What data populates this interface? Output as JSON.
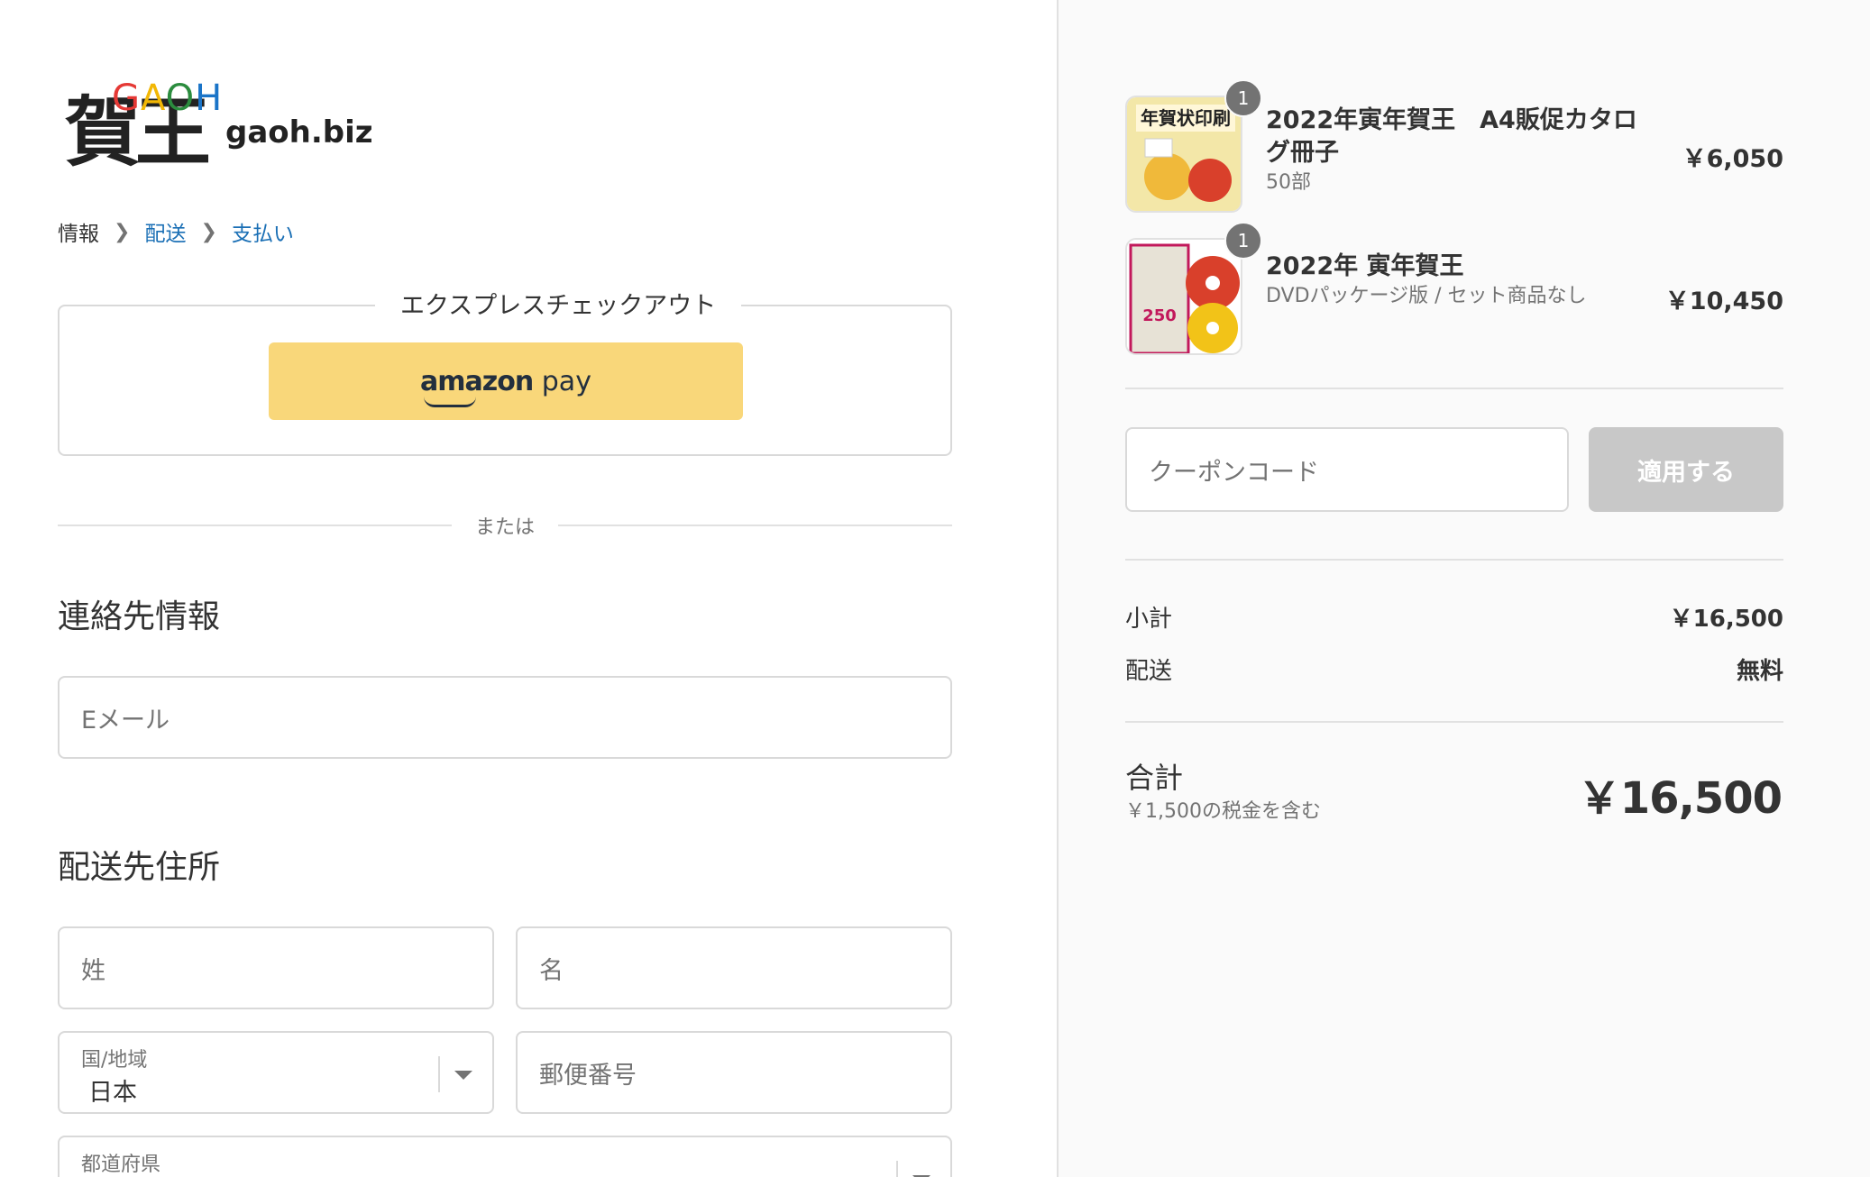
{
  "logo": {
    "kanji": "賀王",
    "abbr_letters": [
      "G",
      "A",
      "O",
      "H"
    ],
    "domain": "gaoh.biz"
  },
  "breadcrumb": [
    {
      "label": "情報"
    },
    {
      "label": "配送"
    },
    {
      "label": "支払い"
    }
  ],
  "express": {
    "legend": "エクスプレスチェックアウト",
    "amazon_brand": "amazon",
    "amazon_suffix": "pay"
  },
  "divider": {
    "or_text": "または"
  },
  "contact": {
    "title": "連絡先情報",
    "email_placeholder": "Eメール"
  },
  "shipping": {
    "title": "配送先住所",
    "last_name_placeholder": "姓",
    "first_name_placeholder": "名",
    "country_label": "国/地域",
    "country_value": "日本",
    "postal_placeholder": "郵便番号",
    "prefecture_label": "都道府県"
  },
  "order": {
    "items": [
      {
        "quantity": "1",
        "name": "2022年寅年賀王　A4販促カタログ冊子",
        "variant": "50部",
        "price": "￥6,050",
        "thumb_text": "年賀状印刷"
      },
      {
        "quantity": "1",
        "name": "2022年 寅年賀王",
        "variant": "DVDパッケージ版 / セット商品なし",
        "price": "￥10,450",
        "thumb_text": "250"
      }
    ],
    "coupon_placeholder": "クーポンコード",
    "apply_label": "適用する",
    "subtotal_label": "小計",
    "subtotal_value": "￥16,500",
    "shipping_label": "配送",
    "shipping_value": "無料",
    "total_label": "合計",
    "tax_note": "￥1,500の税金を含む",
    "total_value": "￥16,500"
  },
  "colors": {
    "link": "#1a6fb5",
    "amazon_button": "#f9d77a",
    "apply_disabled": "#c8c8c8",
    "sidebar_bg": "#fafafa"
  }
}
